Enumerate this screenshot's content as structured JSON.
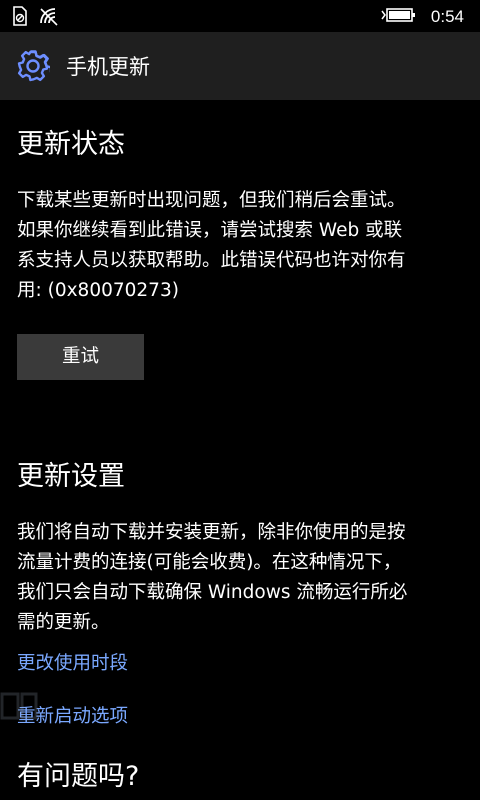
{
  "status_bar": {
    "time": "0:54"
  },
  "header": {
    "title": "手机更新",
    "icon": "gear-icon"
  },
  "update_status": {
    "title": "更新状态",
    "lines": [
      "下载某些更新时出现问题，但我们稍后会重试。",
      "如果你继续看到此错误，请尝试搜索 Web 或联",
      "系支持人员以获取帮助。此错误代码也许对你有",
      "用: (0x80070273)"
    ],
    "retry_label": "重试"
  },
  "update_settings": {
    "title": "更新设置",
    "lines": [
      "我们将自动下载并安装更新，除非你使用的是按",
      "流量计费的连接(可能会收费)。在这种情况下，",
      "我们只会自动下载确保 Windows 流畅运行所必",
      "需的更新。"
    ],
    "link_active_hours": "更改使用时段",
    "link_restart_options": "重新启动选项"
  },
  "next_section": {
    "title": "有问题吗?"
  },
  "colors": {
    "background": "#000000",
    "header": "#1f1f1f",
    "accent": "#7aa8ff",
    "button": "#3a3a3a"
  }
}
